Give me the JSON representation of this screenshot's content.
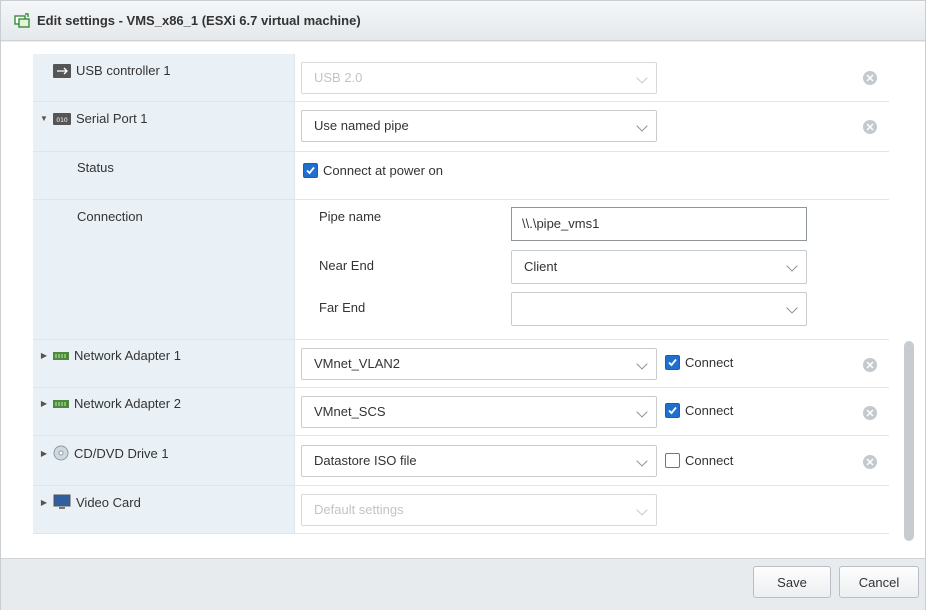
{
  "window": {
    "title": "Edit settings - VMS_x86_1 (ESXi 6.7 virtual machine)"
  },
  "rows": {
    "usb": {
      "label": "USB controller 1",
      "value": "USB 2.0"
    },
    "serial": {
      "label": "Serial Port 1",
      "value": "Use named pipe"
    },
    "status": {
      "label": "Status",
      "checkbox_label": "Connect at power on",
      "checked": true
    },
    "connection": {
      "label": "Connection",
      "pipe_name_label": "Pipe name",
      "pipe_name_value": "\\\\.\\pipe_vms1",
      "near_end_label": "Near End",
      "near_end_value": "Client",
      "far_end_label": "Far End",
      "far_end_value": ""
    },
    "net1": {
      "label": "Network Adapter 1",
      "value": "VMnet_VLAN2",
      "connect_label": "Connect",
      "connected": true
    },
    "net2": {
      "label": "Network Adapter 2",
      "value": "VMnet_SCS",
      "connect_label": "Connect",
      "connected": true
    },
    "cd": {
      "label": "CD/DVD Drive 1",
      "value": "Datastore ISO file",
      "connect_label": "Connect",
      "connected": false
    },
    "video": {
      "label": "Video Card",
      "value": "Default settings"
    }
  },
  "footer": {
    "save_label": "Save",
    "cancel_label": "Cancel"
  },
  "colors": {
    "accent": "#1f6fd1",
    "left_panel": "#eaf1f6",
    "nic_green": "#4c8a3a"
  }
}
